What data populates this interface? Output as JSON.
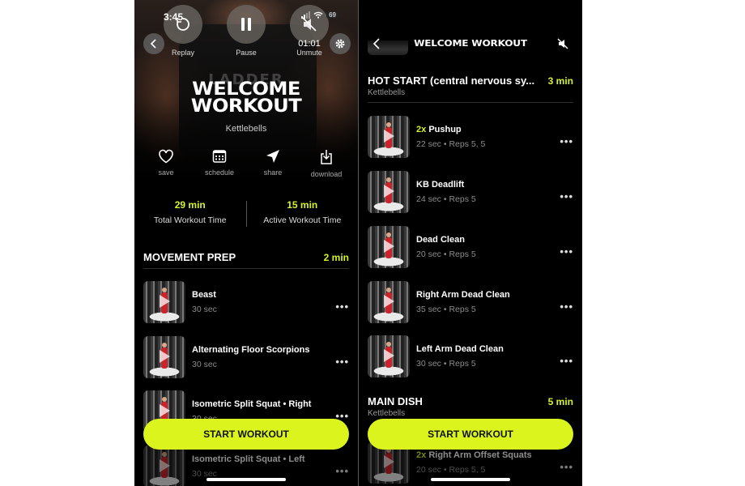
{
  "colors": {
    "accent": "#dbf41e",
    "background": "#000000"
  },
  "left_screen": {
    "status_bar": {
      "time": "3:45",
      "battery": "69"
    },
    "player_controls": {
      "replay": {
        "label": "Replay",
        "icon": "replay-icon"
      },
      "pause": {
        "label": "Pause",
        "icon": "pause-icon"
      },
      "unmute": {
        "label": "Unmute",
        "icon": "mute-icon",
        "time": "01:01"
      }
    },
    "back_icon": "chevron-left-icon",
    "settings_icon": "gear-icon",
    "title_line1": "WELCOME",
    "title_line2": "WORKOUT",
    "subtitle": "Kettlebells",
    "actions": [
      {
        "label": "save",
        "icon": "heart-icon"
      },
      {
        "label": "schedule",
        "icon": "calendar-icon"
      },
      {
        "label": "share",
        "icon": "send-icon"
      },
      {
        "label": "download",
        "icon": "download-icon"
      }
    ],
    "stats": [
      {
        "value": "29 min",
        "caption": "Total Workout Time"
      },
      {
        "value": "15 min",
        "caption": "Active Workout Time"
      }
    ],
    "section": {
      "title": "MOVEMENT PREP",
      "duration": "2 min"
    },
    "exercises": [
      {
        "name": "Beast",
        "meta": "30 sec"
      },
      {
        "name": "Alternating Floor Scorpions",
        "meta": "30 sec"
      },
      {
        "name": "Isometric Split Squat • Right",
        "meta": "30 sec"
      },
      {
        "name": "Isometric Split Squat • Left",
        "meta": "30 sec"
      }
    ],
    "start_button": "START WORKOUT"
  },
  "right_screen": {
    "header_title": "WELCOME WORKOUT",
    "section1": {
      "title": "HOT START (central nervous sy...",
      "duration": "3 min",
      "subtitle": "Kettlebells"
    },
    "exercises": [
      {
        "multiplier": "2x",
        "name": "Pushup",
        "meta": "22 sec • Reps 5, 5"
      },
      {
        "multiplier": "",
        "name": "KB Deadlift",
        "meta": "24 sec • Reps 5"
      },
      {
        "multiplier": "",
        "name": "Dead Clean",
        "meta": "20 sec • Reps 5"
      },
      {
        "multiplier": "",
        "name": "Right Arm Dead Clean",
        "meta": "35 sec • Reps 5"
      },
      {
        "multiplier": "",
        "name": "Left Arm Dead Clean",
        "meta": "30 sec • Reps 5"
      }
    ],
    "section2": {
      "title": "MAIN DISH",
      "duration": "5 min",
      "subtitle": "Kettlebells"
    },
    "section2_exercises": [
      {
        "multiplier": "2x",
        "name": "Right Arm Offset Squats",
        "meta": "20 sec • Reps 5, 5"
      }
    ],
    "start_button": "START WORKOUT"
  }
}
